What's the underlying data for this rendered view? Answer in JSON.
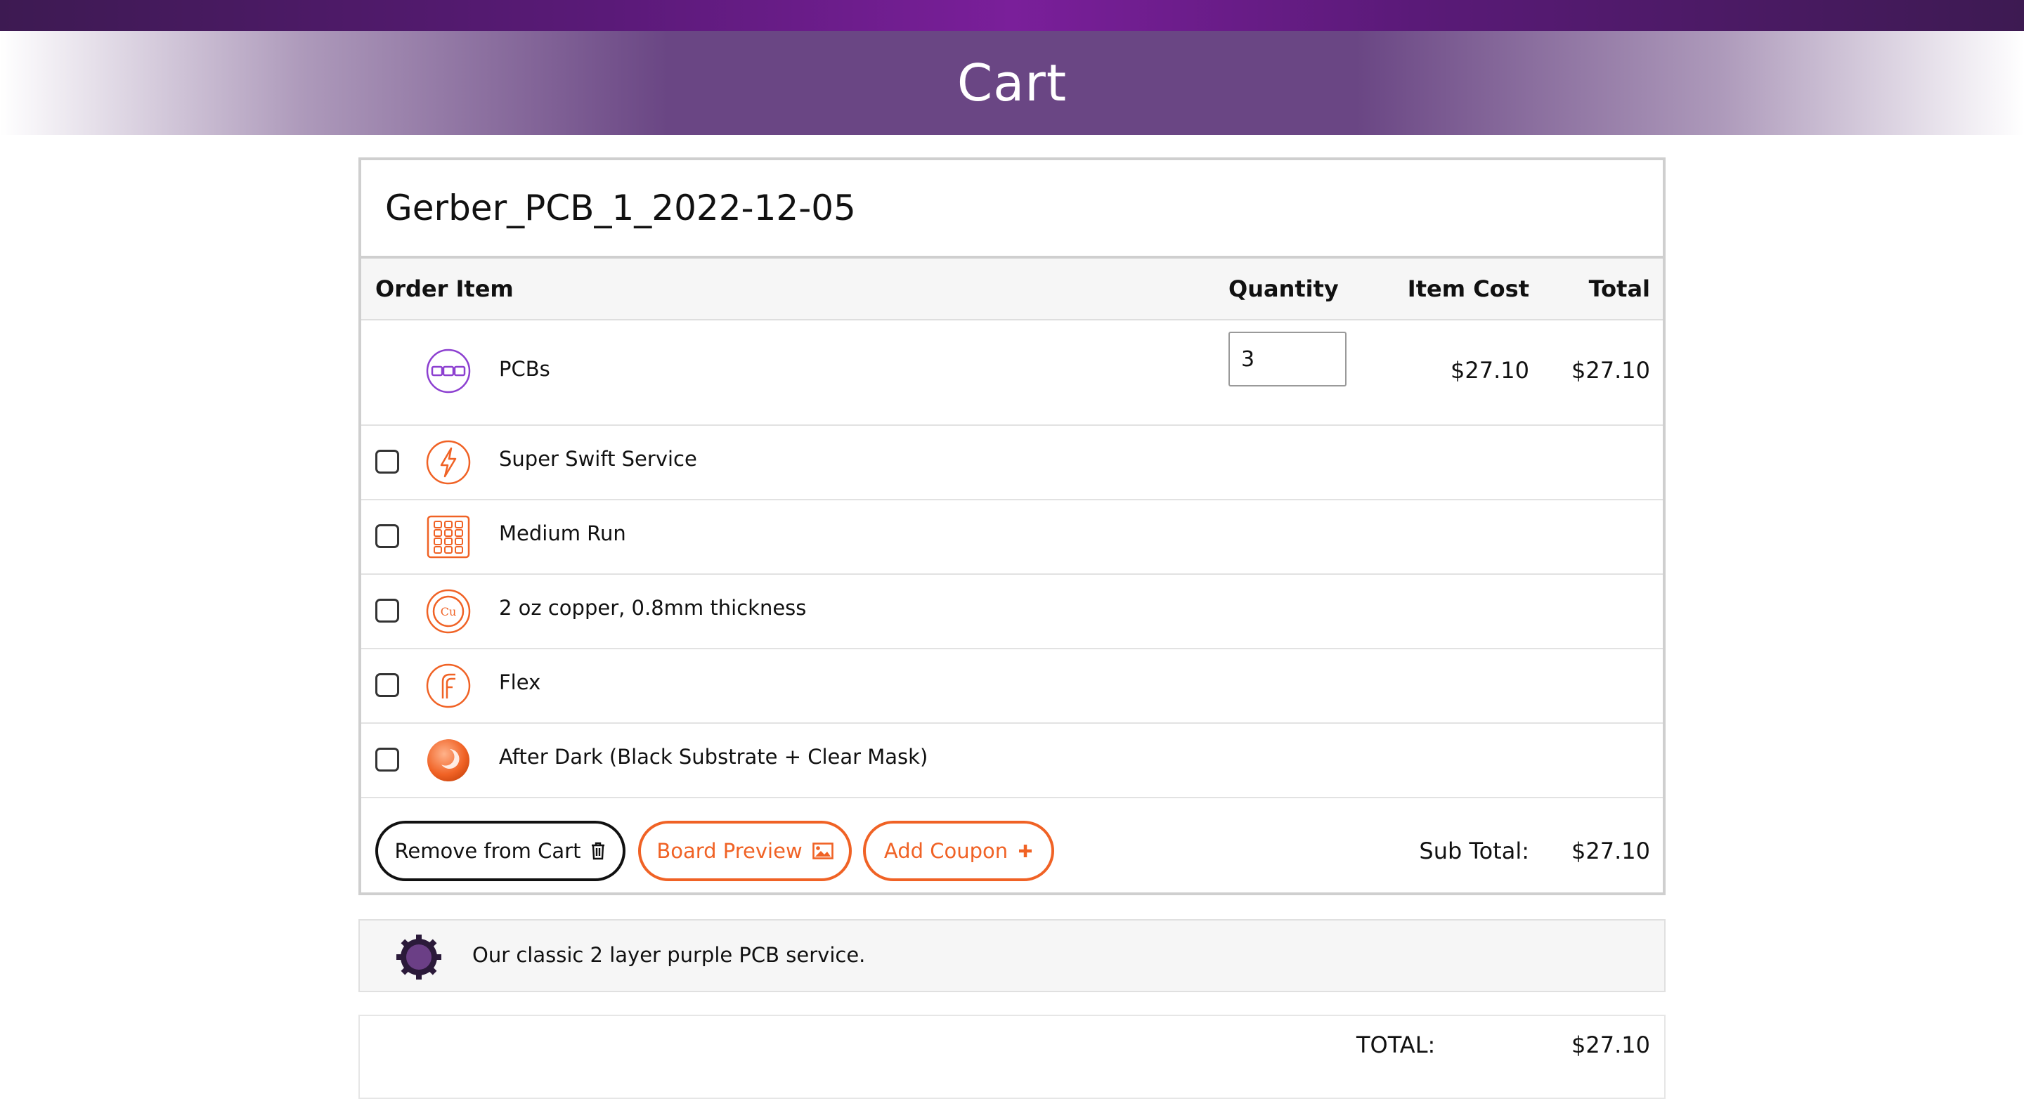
{
  "header": {
    "title": "Cart"
  },
  "order": {
    "name": "Gerber_PCB_1_2022-12-05",
    "columns": {
      "item": "Order Item",
      "quantity": "Quantity",
      "item_cost": "Item Cost",
      "total": "Total"
    },
    "main_item": {
      "label": "PCBs",
      "quantity": "3",
      "item_cost": "$27.10",
      "total": "$27.10",
      "icon": "pcb-icon"
    },
    "options": [
      {
        "label": "Super Swift Service",
        "icon": "lightning-icon",
        "checked": false
      },
      {
        "label": "Medium Run",
        "icon": "grid-panel-icon",
        "checked": false
      },
      {
        "label": "2 oz copper, 0.8mm thickness",
        "icon": "copper-icon",
        "checked": false
      },
      {
        "label": "Flex",
        "icon": "flex-icon",
        "checked": false
      },
      {
        "label": "After Dark (Black Substrate + Clear Mask)",
        "icon": "after-dark-icon",
        "checked": false
      }
    ],
    "buttons": {
      "remove": "Remove from Cart",
      "preview": "Board Preview",
      "coupon": "Add Coupon"
    },
    "subtotal_label": "Sub Total:",
    "subtotal_value": "$27.10"
  },
  "service": {
    "description": "Our classic 2 layer purple PCB service.",
    "icon": "gear-icon"
  },
  "summary": {
    "total_label": "TOTAL:",
    "total_value": "$27.10"
  },
  "colors": {
    "accent": "#f06225",
    "purple": "#6a4684",
    "pcb_icon": "#8c3fd0"
  }
}
